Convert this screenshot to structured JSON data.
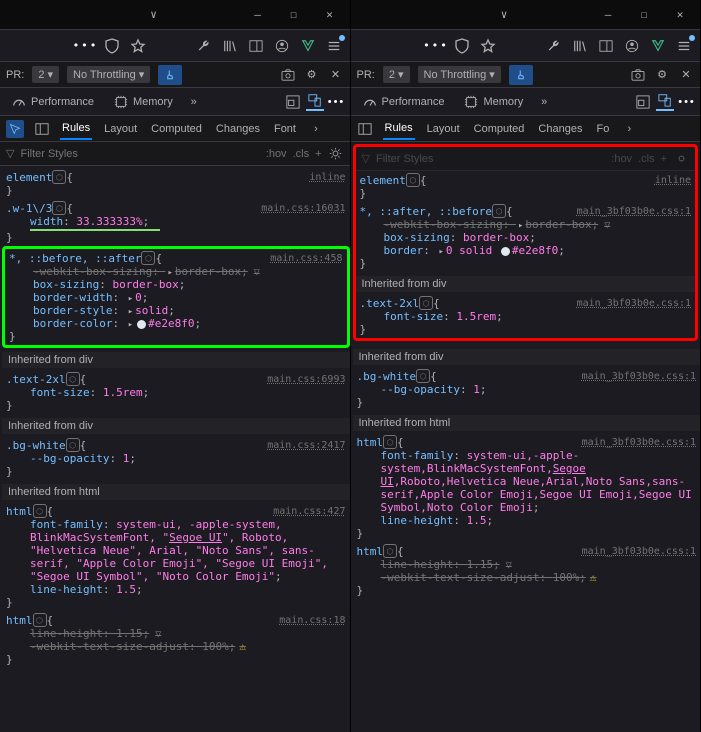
{
  "window": {
    "caret": "∨"
  },
  "toolbar1": {
    "dpr_label": "PR:",
    "dpr_value": "2",
    "throttle_label": "No Throttling"
  },
  "tabs": {
    "performance": "Performance",
    "memory": "Memory"
  },
  "subtabs": {
    "rules": "Rules",
    "layout": "Layout",
    "computed": "Computed",
    "changes": "Changes",
    "fonts": "Font",
    "fonts2": "Fo"
  },
  "filter": {
    "placeholder": "Filter Styles",
    "hov": ":hov",
    "cls": ".cls",
    "plus": "+"
  },
  "left": {
    "r_element": {
      "sel": "element",
      "brace": "{",
      "src": "inline",
      "end": "}"
    },
    "r_w13": {
      "sel": ".w-1\\/3",
      "src": "main.css:16031",
      "p1": "width",
      "v1": "33.333333%"
    },
    "r_star": {
      "sel": "*, ::before, ::after",
      "src": "main.css:458",
      "p1": "-webkit-box-sizing",
      "v1": "border-box",
      "p2": "box-sizing",
      "v2": "border-box",
      "p3": "border-width",
      "v3": "0",
      "p4": "border-style",
      "v4": "solid",
      "p5": "border-color",
      "v5": "#e2e8f0",
      "swatch": "#e2e8f0"
    },
    "inh1": "Inherited from div",
    "r_text2xl": {
      "sel": ".text-2xl",
      "src": "main.css:6993",
      "p1": "font-size",
      "v1": "1.5rem"
    },
    "inh2": "Inherited from div",
    "r_bgwhite": {
      "sel": ".bg-white",
      "src": "main.css:2417",
      "p1": "--bg-opacity",
      "v1": "1"
    },
    "inh3": "Inherited from html",
    "r_html1": {
      "sel": "html",
      "src": "main.css:427",
      "p1": "font-family",
      "v1a": "system-ui, -apple-system, BlinkMacSystemFont, \"",
      "v1b": "Segoe UI",
      "v1c": "\", Roboto, \"Helvetica Neue\", Arial, \"Noto Sans\", sans-serif, \"Apple Color Emoji\", \"Segoe UI Emoji\", \"Segoe UI Symbol\", \"Noto Color Emoji\"",
      "p2": "line-height",
      "v2": "1.5"
    },
    "r_html2": {
      "sel": "html",
      "src": "main.css:18",
      "p1": "line-height",
      "v1": "1.15",
      "p2": "-webkit-text-size-adjust",
      "v2": "100%"
    }
  },
  "right": {
    "r_element": {
      "sel": "element",
      "brace": "{",
      "src": "inline",
      "end": "}"
    },
    "r_star": {
      "sel": "*, ::after, ::before",
      "src": "main_3bf03b0e.css:1",
      "p1": "-webkit-box-sizing",
      "v1": "border-box",
      "p2": "box-sizing",
      "v2": "border-box",
      "p3": "border",
      "v3a": "0",
      "v3b": "solid",
      "v3c": "#e2e8f0",
      "swatch": "#e2e8f0"
    },
    "inh1": "Inherited from div",
    "r_text2xl": {
      "sel": ".text-2xl",
      "src": "main_3bf03b0e.css:1",
      "p1": "font-size",
      "v1": "1.5rem"
    },
    "inh2": "Inherited from div",
    "r_bgwhite": {
      "sel": ".bg-white",
      "src": "main_3bf03b0e.css:1",
      "p1": "--bg-opacity",
      "v1": "1"
    },
    "inh3": "Inherited from html",
    "r_html1": {
      "sel": "html",
      "src": "main_3bf03b0e.css:1",
      "p1": "font-family",
      "v1a": "system-ui,-apple-system,BlinkMacSystemFont,",
      "v1b": "Segoe UI",
      "v1c": ",Roboto,Helvetica Neue,Arial,Noto Sans,sans-serif,Apple Color Emoji,Segoe UI Emoji,Segoe UI Symbol,Noto Color Emoji",
      "p2": "line-height",
      "v2": "1.5"
    },
    "r_html2": {
      "sel": "html",
      "src": "main_3bf03b0e.css:1",
      "p1": "line-height",
      "v1": "1.15",
      "p2": "-webkit-text-size-adjust",
      "v2": "100%"
    }
  },
  "glyph": {
    "shield": "⬡",
    "funnel": "▽",
    "warn": "⚠",
    "expand": "▸",
    "chevdown": "▾",
    "close": "✕",
    "max": "☐",
    "min": "—",
    "plus": "+",
    "gear": "⚙",
    "cam": "◉",
    "more": "»"
  }
}
